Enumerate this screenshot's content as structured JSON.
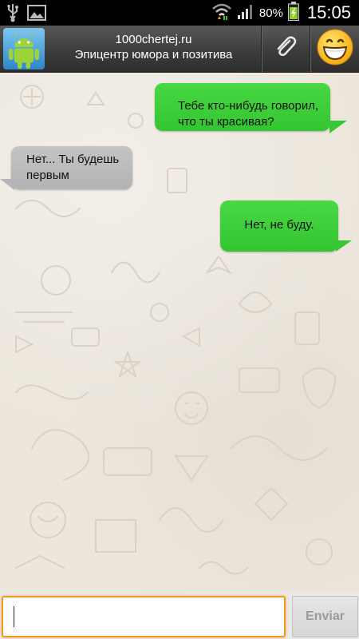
{
  "status_bar": {
    "battery_percent": "80%",
    "time": "15:05",
    "icons": [
      "usb-icon",
      "image-icon",
      "wifi-icon",
      "signal-icon",
      "battery-charging-icon"
    ]
  },
  "header": {
    "title_line1": "1000chertej.ru",
    "title_line2": "Эпицентр юмора и позитива",
    "avatar_icon": "android-icon",
    "attach_icon": "paperclip-icon",
    "emoji_icon": "smiley-icon"
  },
  "messages": [
    {
      "direction": "outgoing",
      "text_line1": "Тебе кто-нибудь говорил,",
      "text_line2": "что ты красивая?"
    },
    {
      "direction": "incoming",
      "text_line1": "Нет... Ты будешь",
      "text_line2": "первым"
    },
    {
      "direction": "outgoing",
      "text_line1": "Нет, не буду.",
      "text_line2": ""
    }
  ],
  "composer": {
    "input_value": "",
    "send_label": "Enviar"
  },
  "colors": {
    "outgoing_bubble": "#3ed13a",
    "incoming_bubble": "#bdbdbd",
    "input_focus": "#f09a1f",
    "header_bg": "#3c3c3c"
  }
}
